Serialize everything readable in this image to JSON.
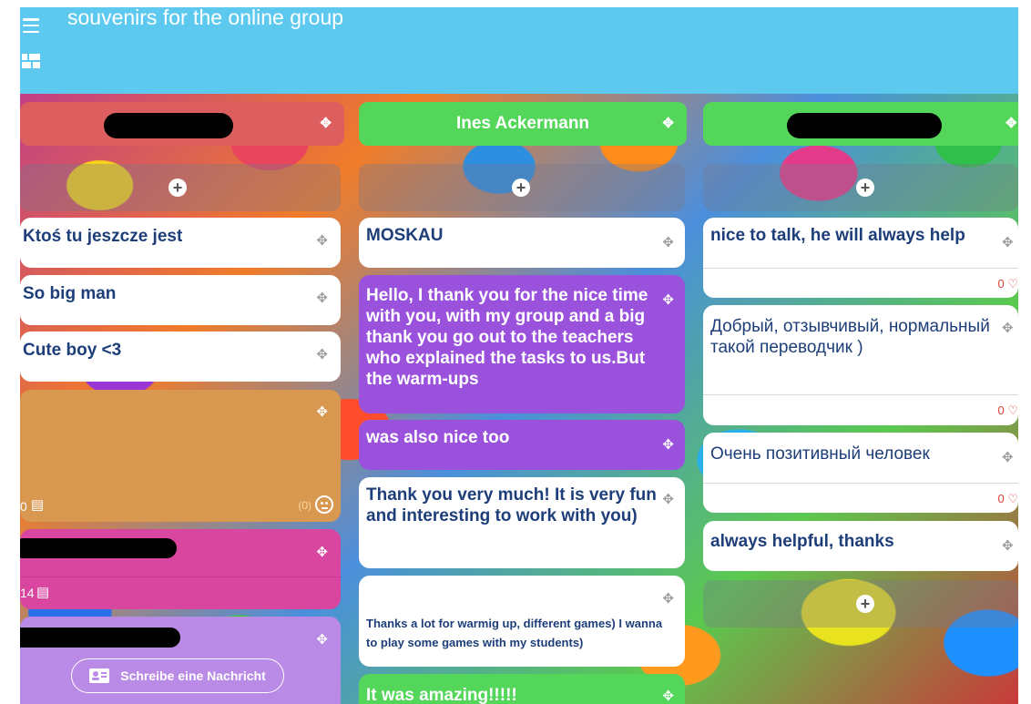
{
  "board": {
    "title": "souvenirs for the online group"
  },
  "icons": {
    "move": "✥",
    "add": "+",
    "comment": "▤",
    "heart": "♡"
  },
  "columns": [
    {
      "header": "",
      "header_color": "#dd5e5e",
      "cards": [
        {
          "text": "Ktoś tu jeszcze jest"
        },
        {
          "text": "So big man"
        },
        {
          "text": "Cute boy <3"
        },
        {
          "text": "",
          "comment_count": "0",
          "reaction_count": "(0)"
        },
        {
          "text": "",
          "comment_count": "14"
        },
        {
          "text": "",
          "button": "Schreibe eine Nachricht"
        }
      ]
    },
    {
      "header": "Ines Ackermann",
      "header_color": "#54d65a",
      "cards": [
        {
          "text": "MOSKAU"
        },
        {
          "text": "Hello, I thank you for the nice time with you, with my group and a big thank you go out to the teachers who explained the tasks to us.But the warm-ups"
        },
        {
          "text": "was also nice too"
        },
        {
          "text": "Thank you very much! It is very fun and interesting to work with you)"
        },
        {
          "text": "Thanks a lot for warmig up, different games) I wanna to play some games with my students)"
        },
        {
          "text": "It was amazing!!!!!"
        }
      ]
    },
    {
      "header": "",
      "header_color": "#54d65a",
      "cards": [
        {
          "text": "nice to talk, he will always help",
          "likes": "0"
        },
        {
          "text": "Добрый, отзывчивый, нормальный такой переводчик )",
          "likes": "0"
        },
        {
          "text": "Очень позитивный человек",
          "likes": "0"
        },
        {
          "text": "always helpful, thanks"
        }
      ]
    }
  ]
}
